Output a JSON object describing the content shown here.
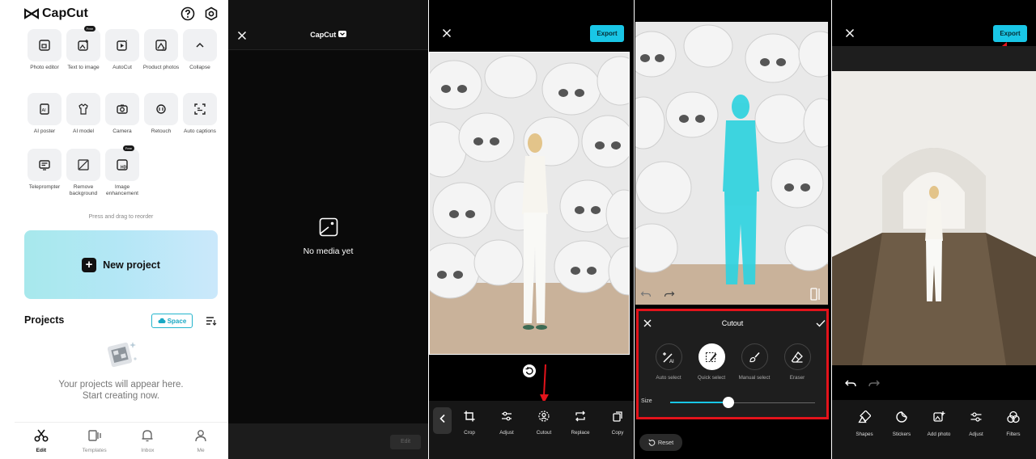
{
  "home": {
    "brand": "CapCut",
    "tools": [
      {
        "label": "Photo editor",
        "icon": "photo-editor-icon"
      },
      {
        "label": "Text to image",
        "icon": "text-to-image-icon",
        "badge": "Free"
      },
      {
        "label": "AutoCut",
        "icon": "autocut-icon"
      },
      {
        "label": "Product photos",
        "icon": "product-photos-icon"
      },
      {
        "label": "Collapse",
        "icon": "chevron-up-icon"
      },
      {
        "label": "AI poster",
        "icon": "ai-poster-icon"
      },
      {
        "label": "AI model",
        "icon": "ai-model-icon"
      },
      {
        "label": "Camera",
        "icon": "camera-icon"
      },
      {
        "label": "Retouch",
        "icon": "retouch-icon"
      },
      {
        "label": "Auto captions",
        "icon": "auto-captions-icon"
      },
      {
        "label": "Teleprompter",
        "icon": "teleprompter-icon"
      },
      {
        "label": "Remove background",
        "icon": "remove-background-icon"
      },
      {
        "label": "Image enhancement",
        "icon": "image-enhancement-icon",
        "badge": "Free"
      }
    ],
    "reorder_hint": "Press and drag to reorder",
    "new_project": "New project",
    "projects_title": "Projects",
    "space_label": "Space",
    "empty_line1": "Your projects will appear here.",
    "empty_line2": "Start creating now.",
    "tabs": [
      {
        "label": "Edit",
        "active": true
      },
      {
        "label": "Templates",
        "active": false
      },
      {
        "label": "Inbox",
        "active": false
      },
      {
        "label": "Me",
        "active": false
      }
    ]
  },
  "empty_editor": {
    "title": "CapCut",
    "no_media": "No media yet",
    "edit_label": "Edit"
  },
  "photo_editor": {
    "export_label": "Export",
    "tools": [
      "Crop",
      "Adjust",
      "Cutout",
      "Replace",
      "Copy"
    ]
  },
  "cutout": {
    "title": "Cutout",
    "options": [
      "Auto select",
      "Quick select",
      "Manual select",
      "Eraser"
    ],
    "selected_option": "Quick select",
    "size_label": "Size",
    "size_value_fraction": 0.4,
    "reset_label": "Reset"
  },
  "final_editor": {
    "export_label": "Export",
    "tools": [
      "Shapes",
      "Stickers",
      "Add photo",
      "Adjust",
      "Filters"
    ]
  },
  "colors": {
    "accent": "#19c6e6",
    "highlight_red": "#e3131b",
    "cutout_mask": "#2fd3df"
  }
}
